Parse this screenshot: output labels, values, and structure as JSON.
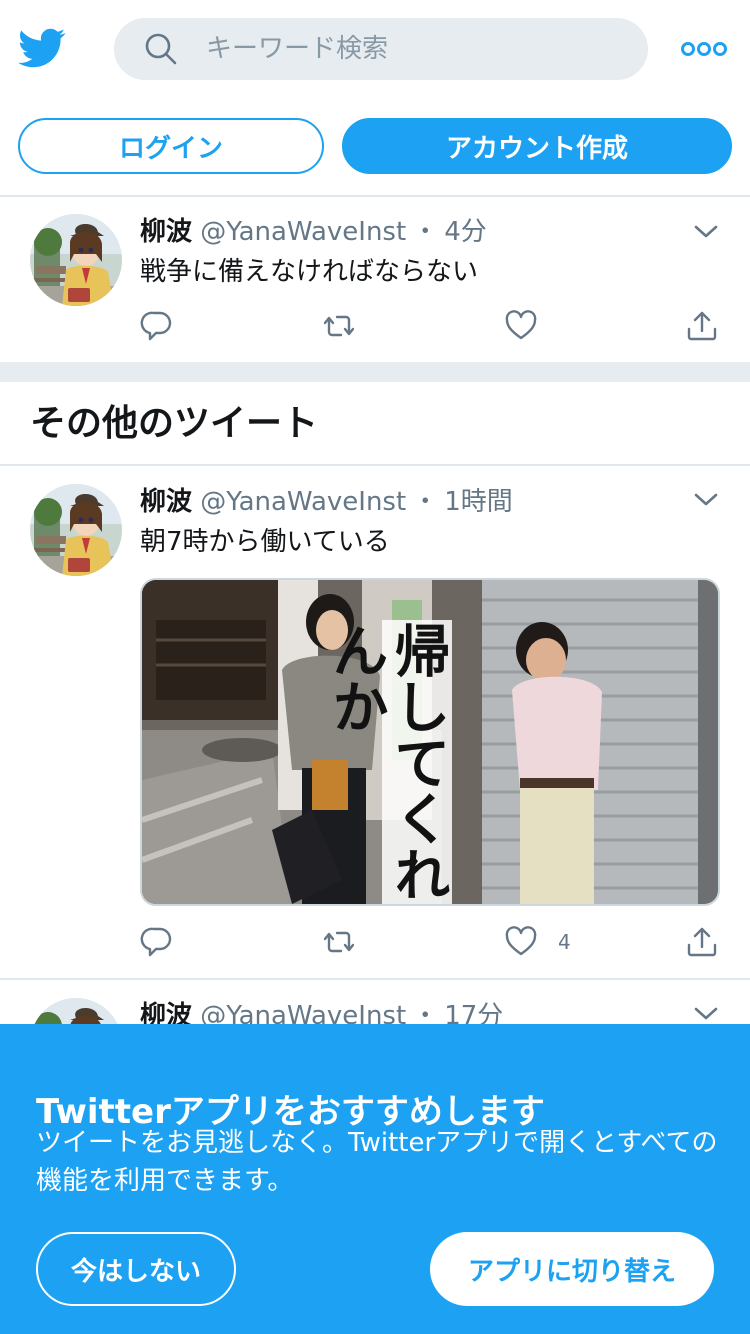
{
  "header": {
    "search_placeholder": "キーワード検索"
  },
  "auth": {
    "login_label": "ログイン",
    "signup_label": "アカウント作成"
  },
  "tweets": [
    {
      "name": "柳波",
      "handle": "@YanaWaveInst",
      "dot": "・",
      "time": "4分",
      "text": "戦争に備えなければならない",
      "like_count": ""
    },
    {
      "name": "柳波",
      "handle": "@YanaWaveInst",
      "dot": "・",
      "time": "1時間",
      "text": "朝7時から働いている",
      "like_count": "4",
      "media_caption": "帰してくれんか"
    },
    {
      "name": "柳波",
      "handle": "@YanaWaveInst",
      "dot": "・",
      "time": "17分"
    }
  ],
  "section_title": "その他のツイート",
  "banner": {
    "title": "Twitterアプリをおすすめします",
    "body": "ツイートをお見逃しなく。Twitterアプリで開くとすべての機能を利用できます。",
    "not_now_label": "今はしない",
    "switch_label": "アプリに切り替え"
  },
  "colors": {
    "brand": "#1da1f2",
    "text": "#14171a",
    "muted": "#657786",
    "divider": "#e1e8ed"
  },
  "icons": [
    "twitter-bird-icon",
    "search-icon",
    "more-dots-icon",
    "chevron-down-icon",
    "reply-icon",
    "retweet-icon",
    "like-icon",
    "share-icon"
  ]
}
